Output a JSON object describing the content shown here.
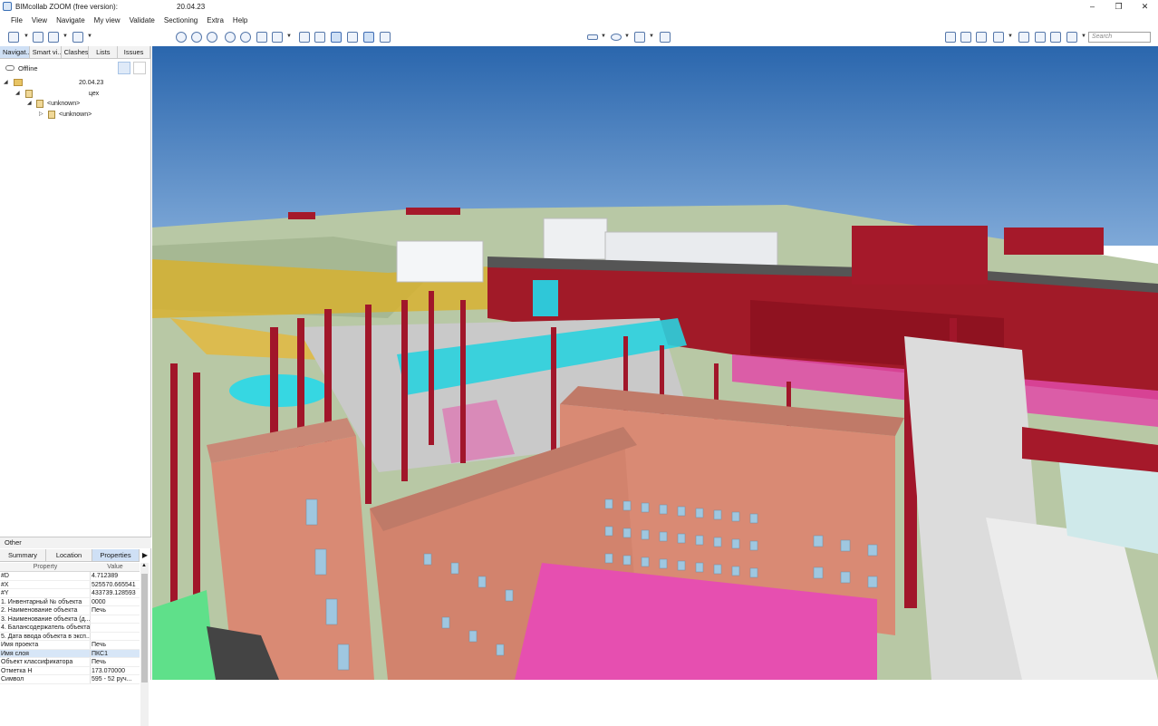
{
  "window": {
    "app_title": "BIMcollab ZOOM (free version):",
    "doc_title": "20.04.23",
    "controls": [
      "–",
      "❐",
      "✕"
    ]
  },
  "menu": [
    "File",
    "View",
    "Navigate",
    "My view",
    "Validate",
    "Sectioning",
    "Extra",
    "Help"
  ],
  "search": {
    "placeholder": "Search"
  },
  "left_tabs": [
    "Navigat...",
    "Smart vi...",
    "Clashes",
    "Lists",
    "Issues"
  ],
  "status": {
    "offline_label": "Offline"
  },
  "tree": {
    "root_label": "20.04.23",
    "building_label": "цех",
    "group_label": "<unknown>",
    "item_label": "<unknown>"
  },
  "other_header": "Other",
  "prop_tabs": [
    "Summary",
    "Location",
    "Properties"
  ],
  "prop_columns": {
    "property": "Property",
    "value": "Value"
  },
  "properties": [
    {
      "k": "#D",
      "v": "4.712389"
    },
    {
      "k": "#X",
      "v": "525570.665541"
    },
    {
      "k": "#Y",
      "v": "433739.128593"
    },
    {
      "k": "1. Инвентарный № объекта",
      "v": "0000"
    },
    {
      "k": "2. Наименование объекта",
      "v": "Печь"
    },
    {
      "k": "3. Наименование объекта (д...",
      "v": ""
    },
    {
      "k": "4. Балансодержатель объекта",
      "v": ""
    },
    {
      "k": "5. Дата ввода объекта в эксп...",
      "v": ""
    },
    {
      "k": "Имя проекта",
      "v": "Печь"
    },
    {
      "k": "Имя слоя",
      "v": "ПКС1"
    },
    {
      "k": "Объект классификатора",
      "v": "Печь"
    },
    {
      "k": "Отметка Н",
      "v": "173.070000"
    },
    {
      "k": "Символ",
      "v": "595 - 52 руч..."
    }
  ],
  "colors": {
    "accent": "#cfe0f5",
    "sky": "#2f6fb6",
    "ground": "#b9c9a2",
    "steel_red": "#a5192a",
    "brick": "#d98a74",
    "magenta": "#e04aa7",
    "cyan_pipe": "#30d0e0"
  }
}
